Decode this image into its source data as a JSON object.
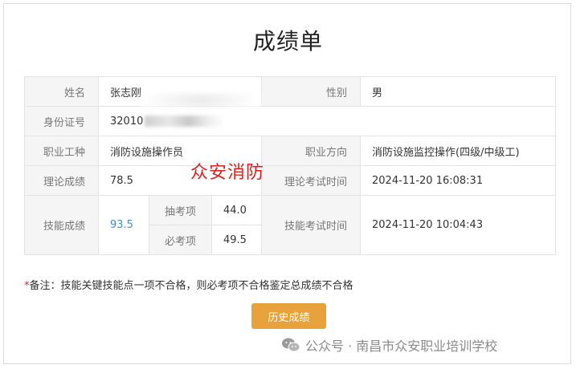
{
  "title": "成绩单",
  "rows": {
    "name_label": "姓名",
    "name_value": "张志刚",
    "gender_label": "性别",
    "gender_value": "男",
    "id_label": "身份证号",
    "id_value": "32010",
    "job_label": "职业工种",
    "job_value": "消防设施操作员",
    "direction_label": "职业方向",
    "direction_value": "消防设施监控操作(四级/中级工)",
    "theory_label": "理论成绩",
    "theory_value": "78.5",
    "theory_time_label": "理论考试时间",
    "theory_time_value": "2024-11-20 16:08:31",
    "skill_label": "技能成绩",
    "skill_value": "93.5",
    "sample_label": "抽考项",
    "sample_value": "44.0",
    "required_label": "必考项",
    "required_value": "49.5",
    "skill_time_label": "技能考试时间",
    "skill_time_value": "2024-11-20 10:04:43"
  },
  "watermark": "众安消防",
  "note": {
    "star": "*",
    "text": "备注：技能关键技能点一项不合格，则必考项不合格鉴定总成绩不合格"
  },
  "history_button": "历史成绩",
  "footer": {
    "icon": "wechat-icon",
    "text": "公众号 · 南昌市众安职业培训学校"
  },
  "colors": {
    "accent_button": "#e7a23c",
    "score_blue": "#3a8ed8",
    "watermark_red": "#e02020"
  }
}
